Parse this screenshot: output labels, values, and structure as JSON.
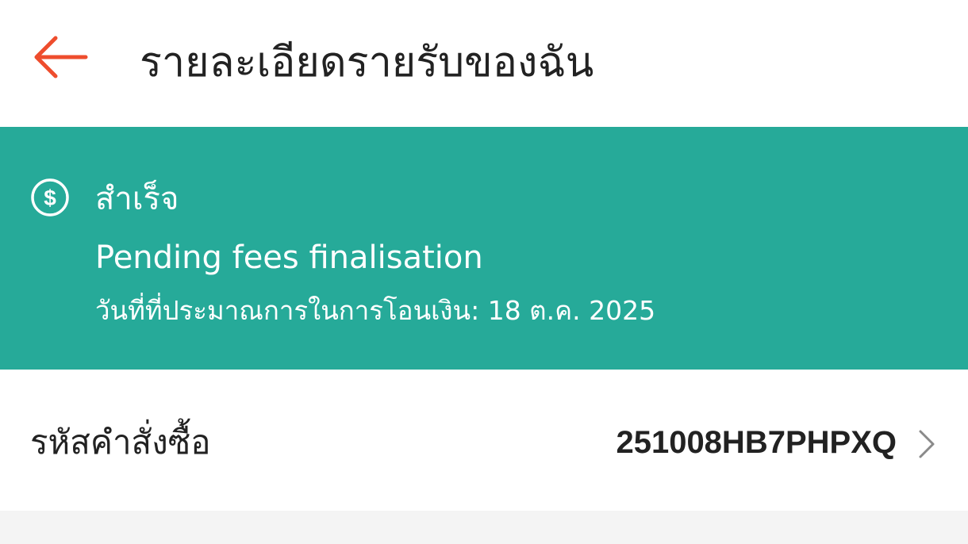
{
  "header": {
    "back_icon": "arrow-left-icon",
    "title": "รายละเอียดรายรับของฉัน",
    "accent_color": "#ee4d2d"
  },
  "status": {
    "icon": "dollar-circle-icon",
    "title": "สำเร็จ",
    "subtitle": "Pending fees finalisation",
    "estimated_transfer_date": "วันที่ที่ประมาณการในการโอนเงิน: 18 ต.ค. 2025",
    "banner_color": "#26aa99"
  },
  "order": {
    "label": "รหัสคำสั่งซื้อ",
    "value": "251008HB7PHPXQ",
    "chevron_icon": "chevron-right-icon"
  }
}
